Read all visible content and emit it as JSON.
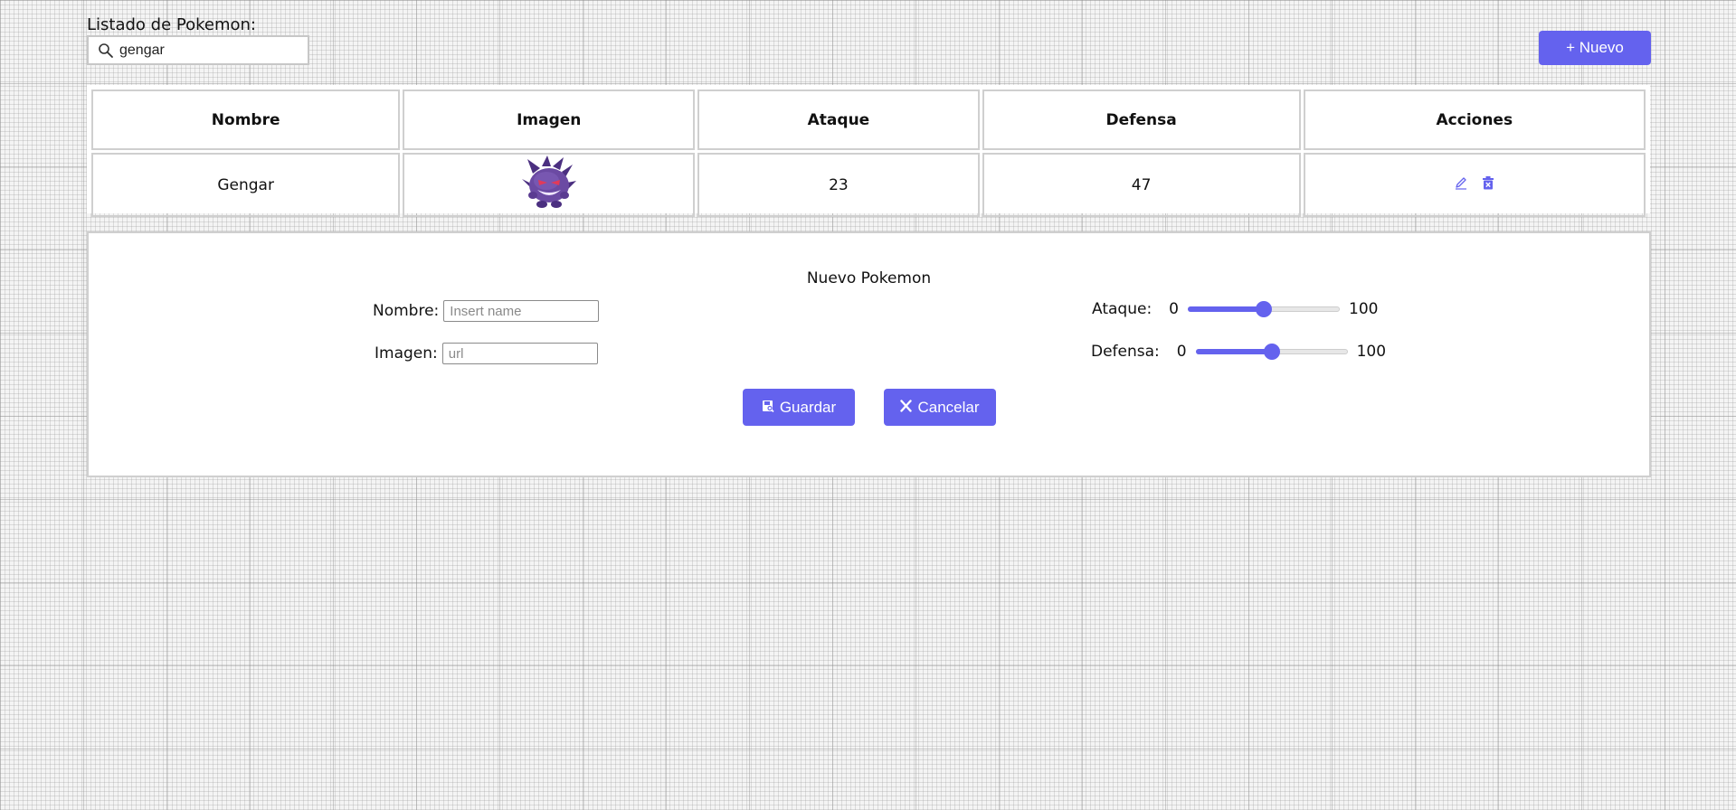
{
  "list": {
    "label": "Listado de Pokemon:",
    "search_value": "gengar",
    "search_icon": "search-icon"
  },
  "toolbar": {
    "new_label": "+ Nuevo"
  },
  "table": {
    "headers": [
      "Nombre",
      "Imagen",
      "Ataque",
      "Defensa",
      "Acciones"
    ],
    "rows": [
      {
        "name": "Gengar",
        "image_alt": "Gengar sprite",
        "attack": "23",
        "defense": "47",
        "actions": [
          "pencil-icon",
          "trash-icon"
        ]
      }
    ]
  },
  "form": {
    "title": "Nuevo Pokemon",
    "name_label": "Nombre:",
    "name_placeholder": "Insert name",
    "image_label": "Imagen:",
    "image_placeholder": "url",
    "attack": {
      "label": "Ataque:",
      "min": "0",
      "max": "100",
      "value": 50
    },
    "defense": {
      "label": "Defensa:",
      "min": "0",
      "max": "100",
      "value": 50
    },
    "save_label": "Guardar",
    "cancel_label": "Cancelar"
  },
  "colors": {
    "accent": "#6462ee",
    "border": "#cfcfcf",
    "gengar_body": "#6b4aa3",
    "gengar_dark": "#4b2f80"
  }
}
